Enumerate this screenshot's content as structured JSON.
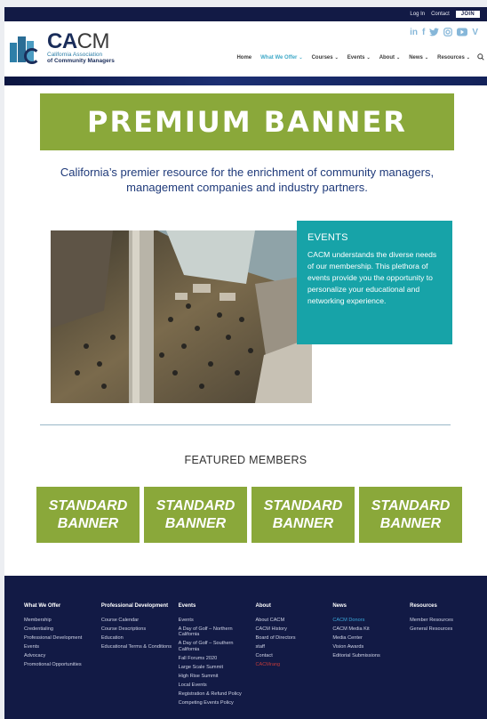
{
  "topbar": {
    "login": "Log In",
    "contact": "Contact",
    "join": "JOIN"
  },
  "logo": {
    "ca": "CA",
    "cm": "CM",
    "line1": "California Association",
    "line2": "of Community Managers"
  },
  "social": [
    {
      "icon": "linkedin-icon",
      "glyph": "in"
    },
    {
      "icon": "facebook-icon",
      "glyph": "f"
    },
    {
      "icon": "twitter-icon",
      "glyph": "🐦"
    },
    {
      "icon": "instagram-icon",
      "glyph": "◎"
    },
    {
      "icon": "youtube-icon",
      "glyph": "▶"
    },
    {
      "icon": "vimeo-icon",
      "glyph": "V"
    }
  ],
  "nav": {
    "home": "Home",
    "what_we_offer": "What We Offer",
    "courses": "Courses",
    "events": "Events",
    "about": "About",
    "news": "News",
    "resources": "Resources"
  },
  "premium_banner": "PREMIUM BANNER",
  "tagline": "California’s premier resource for the enrichment of community managers, management companies and industry partners.",
  "events_box": {
    "title": "EVENTS",
    "text": "CACM understands the diverse needs of our membership. This plethora of events provide you the opportunity to personalize your educational and networking experience."
  },
  "featured": {
    "title": "FEATURED MEMBERS",
    "banners": [
      "STANDARD BANNER",
      "STANDARD BANNER",
      "STANDARD BANNER",
      "STANDARD BANNER"
    ]
  },
  "footer": {
    "what_we_offer": {
      "title": "What We Offer",
      "links": [
        "Membership",
        "Credentialing",
        "Professional Development",
        "Events",
        "Advocacy",
        "Promotional Opportunities"
      ]
    },
    "professional_development": {
      "title": "Professional Development",
      "links": [
        "Course Calendar",
        "Course Descriptions",
        "Education",
        "Educational Terms & Conditions"
      ]
    },
    "events": {
      "title": "Events",
      "links": [
        "Events",
        "A Day of Golf – Northern California",
        "A Day of Golf – Southern California",
        "Fall Forums 2020",
        "Large Scale Summit",
        "High Rise Summit",
        "Local Events",
        "Registration & Refund Policy",
        "Competing Events Policy"
      ]
    },
    "about": {
      "title": "About",
      "links": [
        "About CACM",
        "CACM History",
        "Board of Directors",
        "staff",
        "Contact",
        "CACMrang"
      ]
    },
    "news": {
      "title": "News",
      "links": [
        "CACM Donors",
        "CACM Media Kit",
        "Media Center",
        "Vision Awards",
        "Editorial Submissions"
      ]
    },
    "resources": {
      "title": "Resources",
      "links": [
        "Member Resources",
        "General Resources"
      ]
    }
  },
  "colors": {
    "navy": "#121a45",
    "green": "#8aa83a",
    "teal": "#17a3a8",
    "nav_active": "#3fa9c8",
    "tagline": "#1f3a7a"
  }
}
